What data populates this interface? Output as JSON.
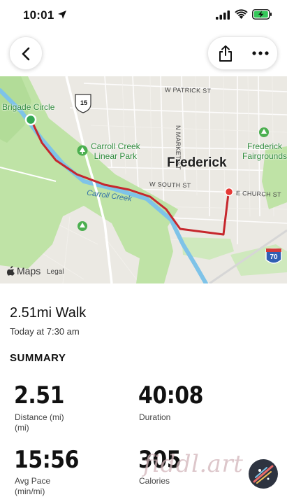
{
  "status_bar": {
    "time": "10:01"
  },
  "map": {
    "streets": {
      "patrick": "W PATRICK ST",
      "market": "N MARKET ST",
      "south": "W SOUTH ST",
      "church": "E CHURCH ST"
    },
    "route_shield": "15",
    "interstate_shield": "70",
    "start_label": "Brigade Circle",
    "park_label_line1": "Carroll Creek",
    "park_label_line2": "Linear Park",
    "city": "Frederick",
    "creek": "Carroll Creek",
    "poi_line1": "Frederick",
    "poi_line2": "Fairgrounds",
    "brand": "Maps",
    "legal": "Legal",
    "colors": {
      "route": "#c6272d",
      "park": "#bfe3a6",
      "water": "#7ec3e8",
      "endpoint": "#e53935",
      "startpoint": "#34a853"
    }
  },
  "workout": {
    "title": "2.51mi Walk",
    "time": "Today at 7:30 am"
  },
  "summary": {
    "heading": "SUMMARY",
    "distance_value": "2.51",
    "distance_label_1": "Distance (mi)",
    "distance_label_2": "(mi)",
    "duration_value": "40:08",
    "duration_label": "Duration",
    "pace_value": "15:56",
    "pace_label_1": "Avg Pace",
    "pace_label_2": "(min/mi)",
    "calories_value": "305",
    "calories_label": "Calories"
  },
  "watermark": "fiddl.art",
  "icons": {
    "back": "chevron-left-icon",
    "share": "share-icon",
    "more": "ellipsis-icon"
  }
}
